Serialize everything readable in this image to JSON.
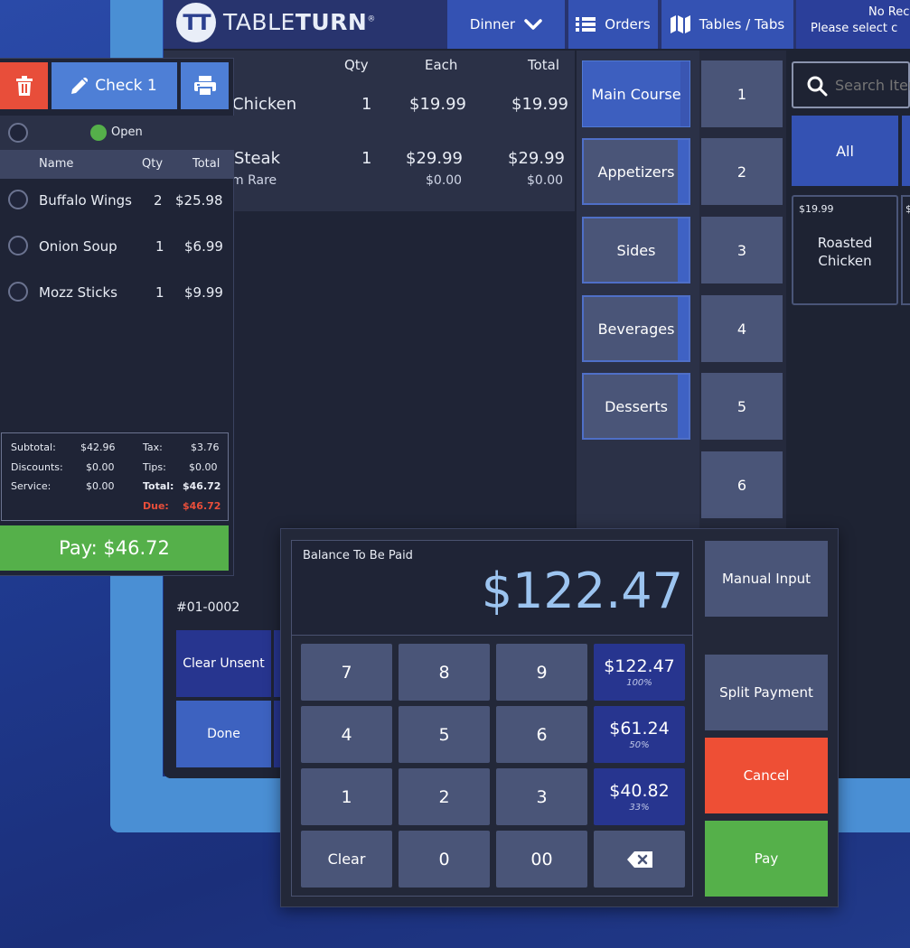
{
  "app": {
    "logo_mark": "TT",
    "logo_light": "TABLE",
    "logo_bold": "TURN",
    "logo_reg": "®"
  },
  "nav": {
    "service": "Dinner",
    "orders": "Orders",
    "tables_tabs": "Tables / Tabs",
    "right_line1": "No Rec",
    "right_line2": "Please select c"
  },
  "items_table": {
    "headers": {
      "qty": "Qty",
      "each": "Each",
      "total": "Total"
    },
    "rows": [
      {
        "name": "Chicken",
        "qty": "1",
        "each": "$19.99",
        "total": "$19.99"
      },
      {
        "name": "Steak",
        "qty": "1",
        "each": "$29.99",
        "total": "$29.99",
        "mod": "m Rare",
        "mod_each": "$0.00",
        "mod_total": "$0.00"
      }
    ]
  },
  "categories": [
    "Main Course",
    "Appetizers",
    "Sides",
    "Beverages",
    "Desserts"
  ],
  "seats": [
    "1",
    "2",
    "3",
    "4",
    "5",
    "6"
  ],
  "menu": {
    "search_placeholder": "Search Iter",
    "all_label": "All",
    "card_price": "$19.99",
    "card_price2": "$",
    "card_name": "Roasted Chicken"
  },
  "order_number": "#01-0002",
  "bottom_buttons": {
    "clear_unsent": "Clear Unsent",
    "done": "Done"
  },
  "check": {
    "title": "Check 1",
    "status": "Open",
    "headers": {
      "name": "Name",
      "qty": "Qty",
      "total": "Total"
    },
    "items": [
      {
        "name": "Buffalo Wings",
        "qty": "2",
        "total": "$25.98"
      },
      {
        "name": "Onion Soup",
        "qty": "1",
        "total": "$6.99"
      },
      {
        "name": "Mozz Sticks",
        "qty": "1",
        "total": "$9.99"
      }
    ],
    "summary": {
      "subtotal_label": "Subtotal:",
      "subtotal": "$42.96",
      "discounts_label": "Discounts:",
      "discounts": "$0.00",
      "service_label": "Service:",
      "service": "$0.00",
      "tax_label": "Tax:",
      "tax": "$3.76",
      "tips_label": "Tips:",
      "tips": "$0.00",
      "total_label": "Total:",
      "total": "$46.72",
      "due_label": "Due:",
      "due": "$46.72"
    },
    "pay_label": "Pay: $46.72"
  },
  "payment": {
    "balance_label": "Balance To Be Paid",
    "balance": "$122.47",
    "keys": [
      "7",
      "8",
      "9",
      "4",
      "5",
      "6",
      "1",
      "2",
      "3",
      "Clear",
      "0",
      "00"
    ],
    "amounts": [
      {
        "value": "$122.47",
        "pct": "100%"
      },
      {
        "value": "$61.24",
        "pct": "50%"
      },
      {
        "value": "$40.82",
        "pct": "33%"
      }
    ],
    "manual_input": "Manual Input",
    "split_payment": "Split Payment",
    "cancel": "Cancel",
    "pay": "Pay"
  },
  "colors": {
    "accent_blue": "#3452b3",
    "danger": "#e84e3a",
    "success": "#55b04a",
    "balance_text": "#9cc4f0"
  },
  "icons": [
    "trash-icon",
    "pencil-icon",
    "printer-icon",
    "chevron-down-icon",
    "list-icon",
    "map-icon",
    "search-icon",
    "backspace-icon"
  ]
}
